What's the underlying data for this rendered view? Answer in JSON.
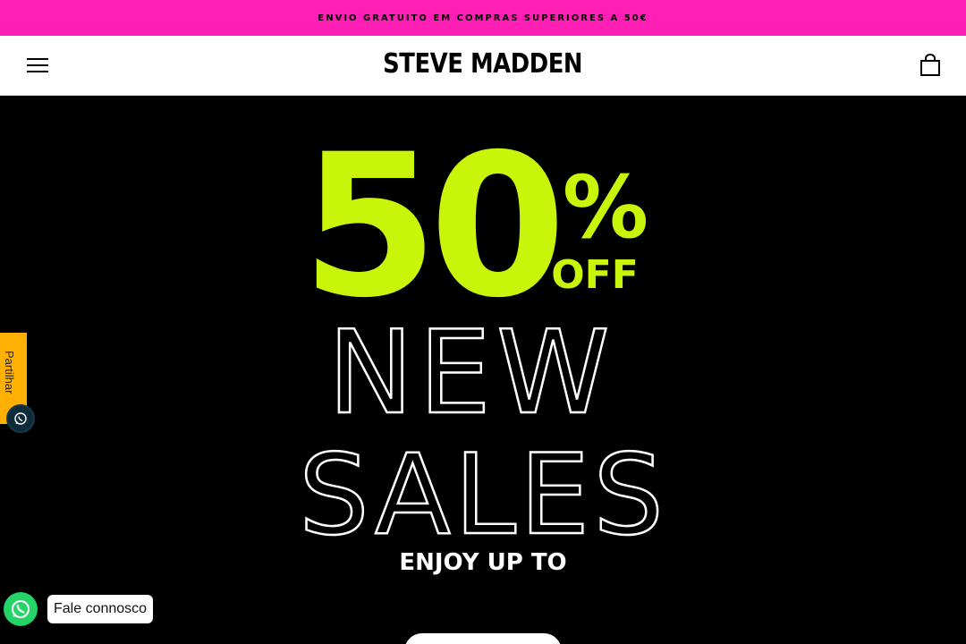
{
  "colors": {
    "announcement_bg": "#ff1fb4",
    "header_bg": "#ffffff",
    "hero_bg": "#000000",
    "promo_accent": "#c8f50a",
    "share_tab_bg": "#ffb000",
    "whatsapp_green": "#25d366"
  },
  "announcement": {
    "text": "ENVIO GRATUITO EM COMPRAS SUPERIORES A 50€"
  },
  "header": {
    "logo_text": "STEVE MADDEN",
    "menu_icon": "hamburger-menu-icon",
    "cart_icon": "shopping-bag-icon"
  },
  "hero": {
    "discount_number": "50",
    "percent_sign": "%",
    "off_text": "OFF",
    "line1": "NEW",
    "line2": "SALES",
    "subline": "ENJOY UP TO"
  },
  "share_tab": {
    "label": "Partilhar",
    "icon": "whatsapp-icon"
  },
  "whatsapp_chat": {
    "icon": "whatsapp-icon",
    "label": "Fale connosco"
  }
}
